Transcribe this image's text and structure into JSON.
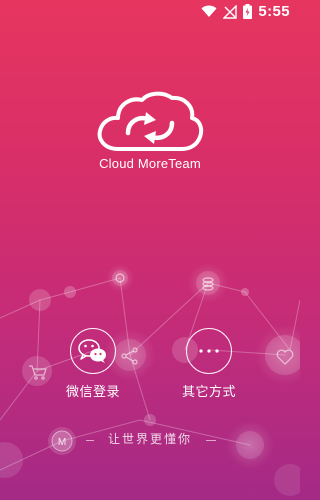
{
  "status_bar": {
    "time": "5:55"
  },
  "brand": {
    "name": "Cloud MoreTeam"
  },
  "login_options": {
    "wechat_label": "微信登录",
    "other_label": "其它方式"
  },
  "tagline": {
    "text": "让世界更懂你",
    "node_letter": "M"
  },
  "colors": {
    "background_top": "#e6355f",
    "background_bottom": "#a42a86"
  }
}
